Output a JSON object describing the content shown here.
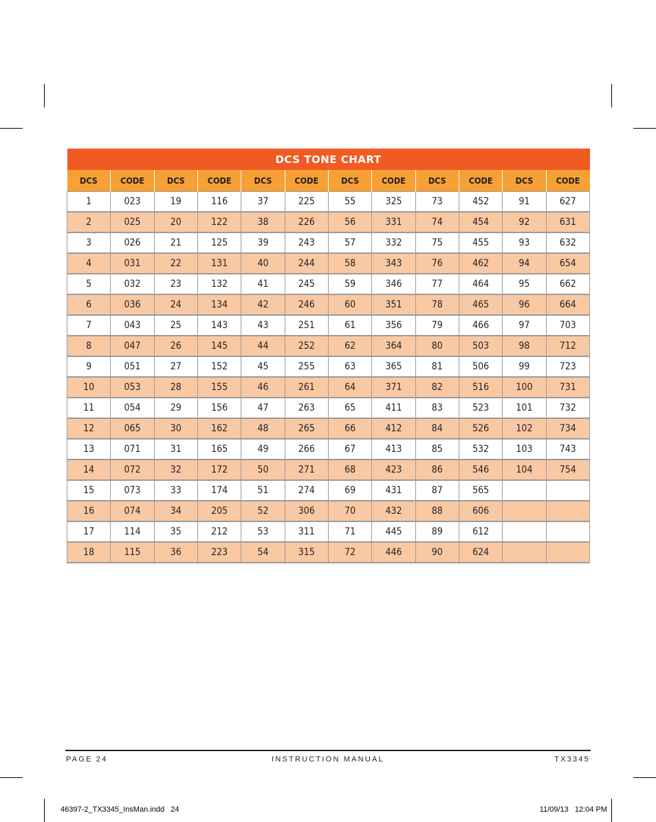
{
  "table": {
    "title": "DCS TONE CHART",
    "headers": [
      "DCS",
      "CODE",
      "DCS",
      "CODE",
      "DCS",
      "CODE",
      "DCS",
      "CODE",
      "DCS",
      "CODE",
      "DCS",
      "CODE"
    ],
    "rows": [
      [
        "1",
        "023",
        "19",
        "116",
        "37",
        "225",
        "55",
        "325",
        "73",
        "452",
        "91",
        "627"
      ],
      [
        "2",
        "025",
        "20",
        "122",
        "38",
        "226",
        "56",
        "331",
        "74",
        "454",
        "92",
        "631"
      ],
      [
        "3",
        "026",
        "21",
        "125",
        "39",
        "243",
        "57",
        "332",
        "75",
        "455",
        "93",
        "632"
      ],
      [
        "4",
        "031",
        "22",
        "131",
        "40",
        "244",
        "58",
        "343",
        "76",
        "462",
        "94",
        "654"
      ],
      [
        "5",
        "032",
        "23",
        "132",
        "41",
        "245",
        "59",
        "346",
        "77",
        "464",
        "95",
        "662"
      ],
      [
        "6",
        "036",
        "24",
        "134",
        "42",
        "246",
        "60",
        "351",
        "78",
        "465",
        "96",
        "664"
      ],
      [
        "7",
        "043",
        "25",
        "143",
        "43",
        "251",
        "61",
        "356",
        "79",
        "466",
        "97",
        "703"
      ],
      [
        "8",
        "047",
        "26",
        "145",
        "44",
        "252",
        "62",
        "364",
        "80",
        "503",
        "98",
        "712"
      ],
      [
        "9",
        "051",
        "27",
        "152",
        "45",
        "255",
        "63",
        "365",
        "81",
        "506",
        "99",
        "723"
      ],
      [
        "10",
        "053",
        "28",
        "155",
        "46",
        "261",
        "64",
        "371",
        "82",
        "516",
        "100",
        "731"
      ],
      [
        "11",
        "054",
        "29",
        "156",
        "47",
        "263",
        "65",
        "411",
        "83",
        "523",
        "101",
        "732"
      ],
      [
        "12",
        "065",
        "30",
        "162",
        "48",
        "265",
        "66",
        "412",
        "84",
        "526",
        "102",
        "734"
      ],
      [
        "13",
        "071",
        "31",
        "165",
        "49",
        "266",
        "67",
        "413",
        "85",
        "532",
        "103",
        "743"
      ],
      [
        "14",
        "072",
        "32",
        "172",
        "50",
        "271",
        "68",
        "423",
        "86",
        "546",
        "104",
        "754"
      ],
      [
        "15",
        "073",
        "33",
        "174",
        "51",
        "274",
        "69",
        "431",
        "87",
        "565",
        "",
        ""
      ],
      [
        "16",
        "074",
        "34",
        "205",
        "52",
        "306",
        "70",
        "432",
        "88",
        "606",
        "",
        ""
      ],
      [
        "17",
        "114",
        "35",
        "212",
        "53",
        "311",
        "71",
        "445",
        "89",
        "612",
        "",
        ""
      ],
      [
        "18",
        "115",
        "36",
        "223",
        "54",
        "315",
        "72",
        "446",
        "90",
        "624",
        "",
        ""
      ]
    ]
  },
  "colors": {
    "title_bg": "#f15a22",
    "header_bg": "#f7a035",
    "stripe_bg": "#f9c9a4",
    "row_bg": "#ffffff"
  },
  "footer": {
    "page": "PAGE 24",
    "manual": "INSTRUCTION MANUAL",
    "model": "TX3345"
  },
  "slug": {
    "file": "46397-2_TX3345_InsMan.indd   24",
    "datetime": "11/09/13   12:04 PM"
  }
}
